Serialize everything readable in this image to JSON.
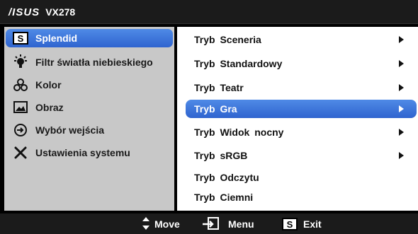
{
  "header": {
    "brand": "/ISUS",
    "model": "VX278"
  },
  "sidebar": {
    "items": [
      {
        "label": "Splendid",
        "icon": "splendid-s-icon",
        "selected": true
      },
      {
        "label": "Filtr światła niebieskiego",
        "icon": "blue-light-filter-icon"
      },
      {
        "label": "Kolor",
        "icon": "color-icon"
      },
      {
        "label": "Obraz",
        "icon": "image-icon"
      },
      {
        "label": "Wybór wejścia",
        "icon": "input-select-icon"
      },
      {
        "label": "Ustawienia systemu",
        "icon": "system-settings-icon"
      }
    ],
    "s_badge": "S"
  },
  "main": {
    "options": [
      {
        "label": "Tryb Sceneria",
        "has_arrow": true
      },
      {
        "label": "Tryb Standardowy",
        "has_arrow": true
      },
      {
        "label": "Tryb Teatr",
        "has_arrow": true
      },
      {
        "label": "Tryb Gra",
        "has_arrow": true,
        "selected": true
      },
      {
        "label": "Tryb Widok nocny",
        "has_arrow": true
      },
      {
        "label": "Tryb sRGB",
        "has_arrow": true
      },
      {
        "label": "Tryb Odczytu",
        "has_arrow": false
      },
      {
        "label": "Tryb Ciemni",
        "has_arrow": false
      }
    ]
  },
  "footer": {
    "move": "Move",
    "menu": "Menu",
    "exit": "Exit",
    "exit_badge": "S"
  },
  "colors": {
    "accent": "#3a72dc",
    "sidebar_bg": "#c8c8c8",
    "bar_bg": "#1b1b1b"
  }
}
